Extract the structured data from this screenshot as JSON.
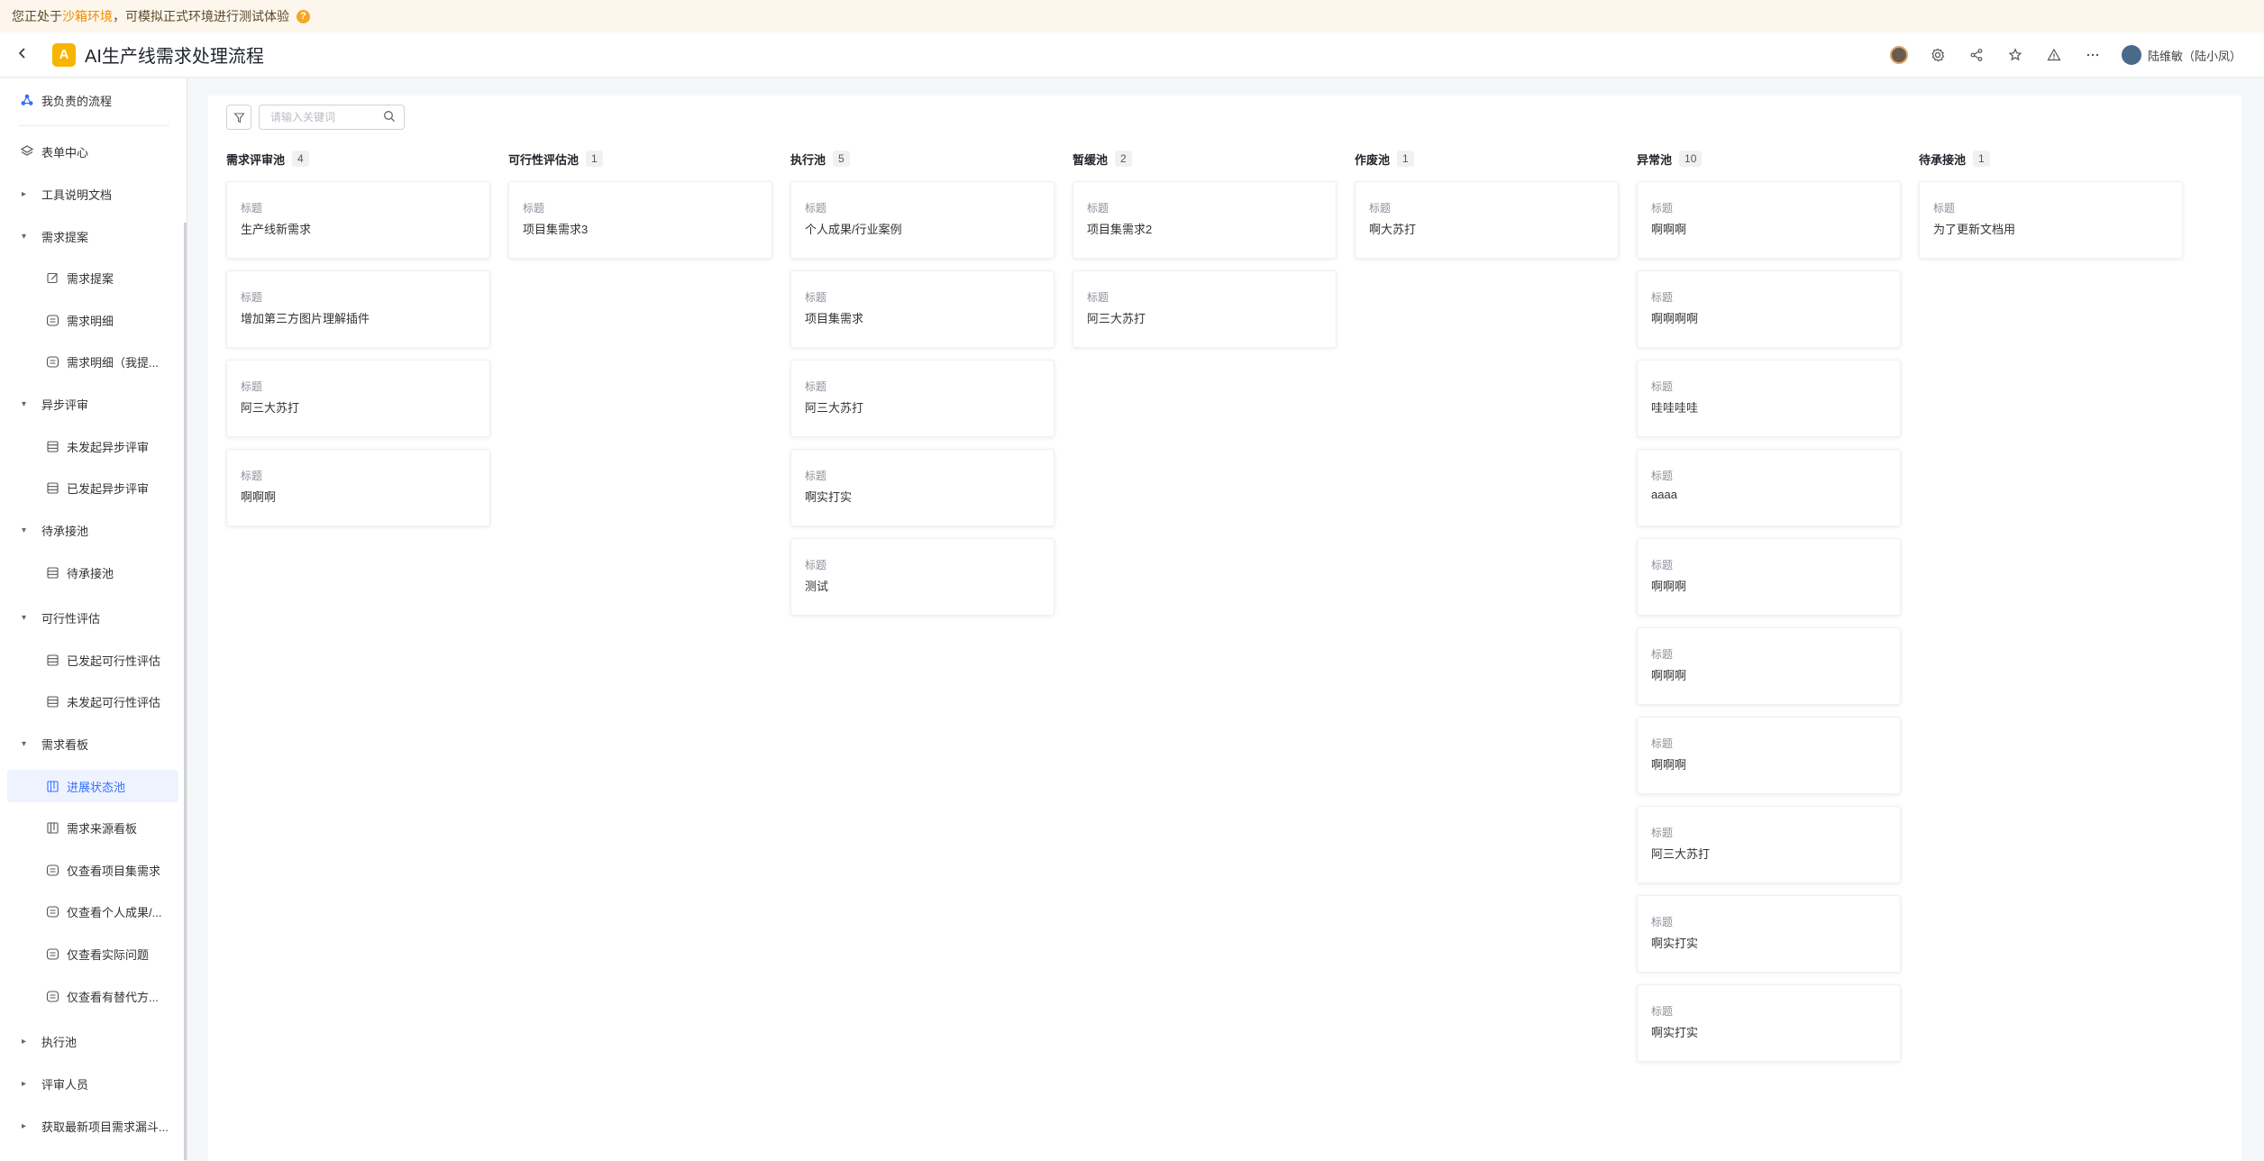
{
  "banner": {
    "prefix": "您正处于",
    "highlight": "沙箱环境",
    "suffix": "，可模拟正式环境进行测试体验",
    "help_icon": "?"
  },
  "header": {
    "back_icon": "chevron-left-icon",
    "app_logo_letter": "A",
    "title": "AI生产线需求处理流程",
    "user_name": "陆维敏（陆小凤）"
  },
  "sidebar": {
    "my_flows": "我负责的流程",
    "form_center": "表单中心",
    "items": [
      {
        "label": "工具说明文档",
        "kind": "group",
        "caret": "▸"
      },
      {
        "label": "需求提案",
        "kind": "group",
        "caret": "▾"
      },
      {
        "label": "需求提案",
        "kind": "child",
        "icon": "edit-icon"
      },
      {
        "label": "需求明细",
        "kind": "child",
        "icon": "list-icon"
      },
      {
        "label": "需求明细（我提...",
        "kind": "child",
        "icon": "list-icon"
      },
      {
        "label": "异步评审",
        "kind": "group",
        "caret": "▾"
      },
      {
        "label": "未发起异步评审",
        "kind": "child",
        "icon": "table-icon"
      },
      {
        "label": "已发起异步评审",
        "kind": "child",
        "icon": "table-icon"
      },
      {
        "label": "待承接池",
        "kind": "group",
        "caret": "▾"
      },
      {
        "label": "待承接池",
        "kind": "child",
        "icon": "table-icon"
      },
      {
        "label": "可行性评估",
        "kind": "group",
        "caret": "▾"
      },
      {
        "label": "已发起可行性评估",
        "kind": "child",
        "icon": "table-icon"
      },
      {
        "label": "未发起可行性评估",
        "kind": "child",
        "icon": "table-icon"
      },
      {
        "label": "需求看板",
        "kind": "group",
        "caret": "▾"
      },
      {
        "label": "进展状态池",
        "kind": "child",
        "icon": "kanban-icon",
        "active": true
      },
      {
        "label": "需求来源看板",
        "kind": "child",
        "icon": "kanban-icon"
      },
      {
        "label": "仅查看项目集需求",
        "kind": "child",
        "icon": "list-icon"
      },
      {
        "label": "仅查看个人成果/...",
        "kind": "child",
        "icon": "list-icon"
      },
      {
        "label": "仅查看实际问题",
        "kind": "child",
        "icon": "list-icon"
      },
      {
        "label": "仅查看有替代方...",
        "kind": "child",
        "icon": "list-icon"
      },
      {
        "label": "执行池",
        "kind": "group",
        "caret": "▸"
      },
      {
        "label": "评审人员",
        "kind": "group",
        "caret": "▸"
      },
      {
        "label": "获取最新项目需求漏斗...",
        "kind": "group",
        "caret": "▸"
      }
    ]
  },
  "toolbar": {
    "search_placeholder": "请输入关键词"
  },
  "board": {
    "field_label": "标题",
    "columns": [
      {
        "name": "需求评审池",
        "count": "4",
        "cards": [
          "生产线新需求",
          "增加第三方图片理解插件",
          "阿三大苏打",
          "啊啊啊"
        ]
      },
      {
        "name": "可行性评估池",
        "count": "1",
        "cards": [
          "项目集需求3"
        ]
      },
      {
        "name": "执行池",
        "count": "5",
        "cards": [
          "个人成果/行业案例",
          "项目集需求",
          "阿三大苏打",
          "啊实打实",
          "测试"
        ]
      },
      {
        "name": "暂缓池",
        "count": "2",
        "cards": [
          "项目集需求2",
          "阿三大苏打"
        ]
      },
      {
        "name": "作废池",
        "count": "1",
        "cards": [
          "啊大苏打"
        ]
      },
      {
        "name": "异常池",
        "count": "10",
        "cards": [
          "啊啊啊",
          "啊啊啊啊",
          "哇哇哇哇",
          "aaaa",
          "啊啊啊",
          "啊啊啊",
          "啊啊啊",
          "阿三大苏打",
          "啊实打实",
          "啊实打实"
        ]
      },
      {
        "name": "待承接池",
        "count": "1",
        "cards": [
          "为了更新文档用"
        ]
      }
    ]
  }
}
